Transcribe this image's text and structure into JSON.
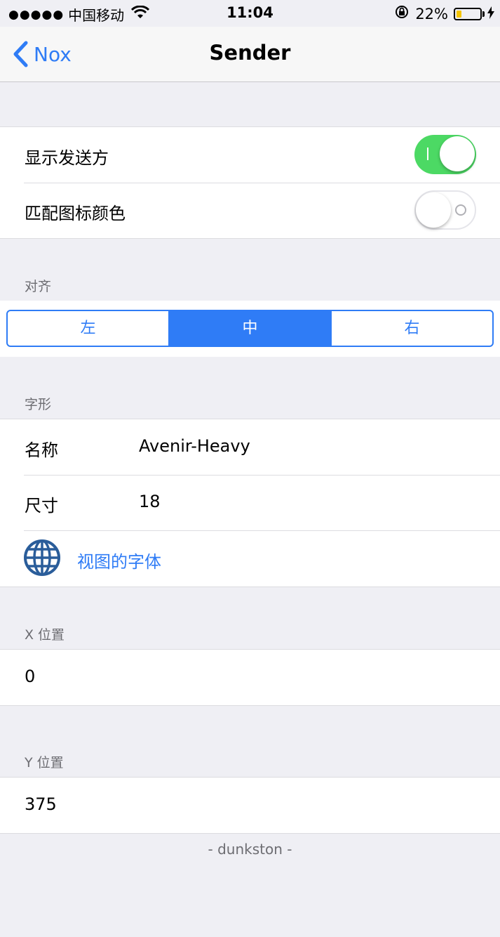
{
  "status_bar": {
    "signal": "●●●●●",
    "carrier": "中国移动",
    "time": "11:04",
    "battery_percent": "22%",
    "battery_level": 0.22
  },
  "nav": {
    "back_label": "Nox",
    "title": "Sender"
  },
  "toggles": [
    {
      "label": "显示发送方",
      "on": true
    },
    {
      "label": "匹配图标颜色",
      "on": false
    }
  ],
  "alignment": {
    "header": "对齐",
    "options": [
      "左",
      "中",
      "右"
    ],
    "selected": "中"
  },
  "font": {
    "header": "字形",
    "name_label": "名称",
    "name_value": "Avenir-Heavy",
    "size_label": "尺寸",
    "size_value": "18",
    "link_label": "视图的字体"
  },
  "x_position": {
    "header": "X 位置",
    "value": "0"
  },
  "y_position": {
    "header": "Y 位置",
    "value": "375"
  },
  "footer": "- dunkston -",
  "colors": {
    "accent": "#2f7cf6",
    "switch_on": "#4cd964",
    "background": "#efeff4",
    "battery": "#f4c400"
  }
}
